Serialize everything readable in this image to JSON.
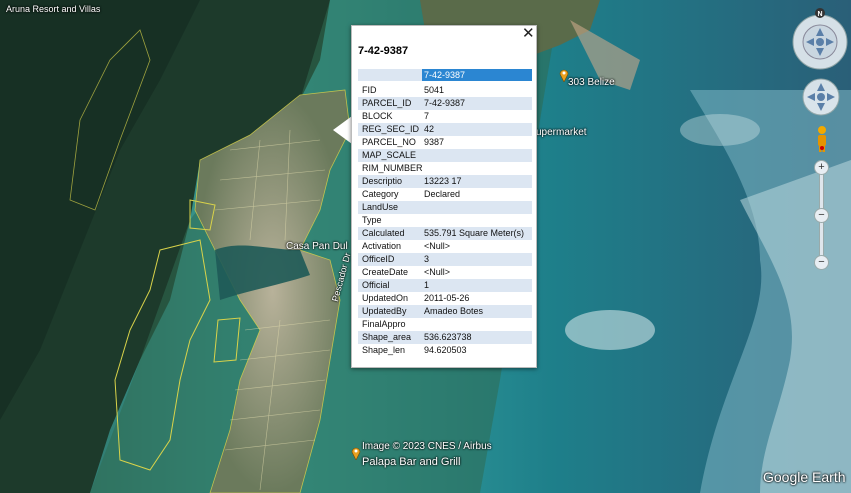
{
  "map": {
    "labels": {
      "resort": "Aruna Resort and Villas",
      "poi_303": "303 Belize",
      "supermarket": "upermarket",
      "casa": "Casa Pan Dul",
      "road": "Pescador Dr",
      "copyright": "Image © 2023 CNES / Airbus",
      "palapa": "Palapa Bar and Grill",
      "brand": "Google Earth"
    },
    "compass_letter": "N",
    "zoom_plus": "+",
    "zoom_minus": "−",
    "pin_color": "#e8a020"
  },
  "popup": {
    "title": "7-42-9387",
    "header_value": "7-42-9387",
    "close_label": "✕",
    "rows": [
      {
        "key": "FID",
        "value": "5041"
      },
      {
        "key": "PARCEL_ID",
        "value": "7-42-9387"
      },
      {
        "key": "BLOCK",
        "value": "7"
      },
      {
        "key": "REG_SEC_ID",
        "value": "42"
      },
      {
        "key": "PARCEL_NO",
        "value": "9387"
      },
      {
        "key": "MAP_SCALE",
        "value": ""
      },
      {
        "key": "RIM_NUMBER",
        "value": ""
      },
      {
        "key": "Descriptio",
        "value": "13223 17"
      },
      {
        "key": "Category",
        "value": "Declared"
      },
      {
        "key": "LandUse",
        "value": ""
      },
      {
        "key": "Type",
        "value": ""
      },
      {
        "key": "Calculated",
        "value": "535.791 Square Meter(s)"
      },
      {
        "key": "Activation",
        "value": "<Null>"
      },
      {
        "key": "OfficeID",
        "value": "3"
      },
      {
        "key": "CreateDate",
        "value": "<Null>"
      },
      {
        "key": "Official",
        "value": "1"
      },
      {
        "key": "UpdatedOn",
        "value": "2011-05-26"
      },
      {
        "key": "UpdatedBy",
        "value": "Amadeo Botes"
      },
      {
        "key": "FinalAppro",
        "value": ""
      },
      {
        "key": "Shape_area",
        "value": "536.623738"
      },
      {
        "key": "Shape_len",
        "value": "94.620503"
      }
    ],
    "highlight_color": "#2b86d2",
    "alt_row_color": "#dce6f2"
  }
}
